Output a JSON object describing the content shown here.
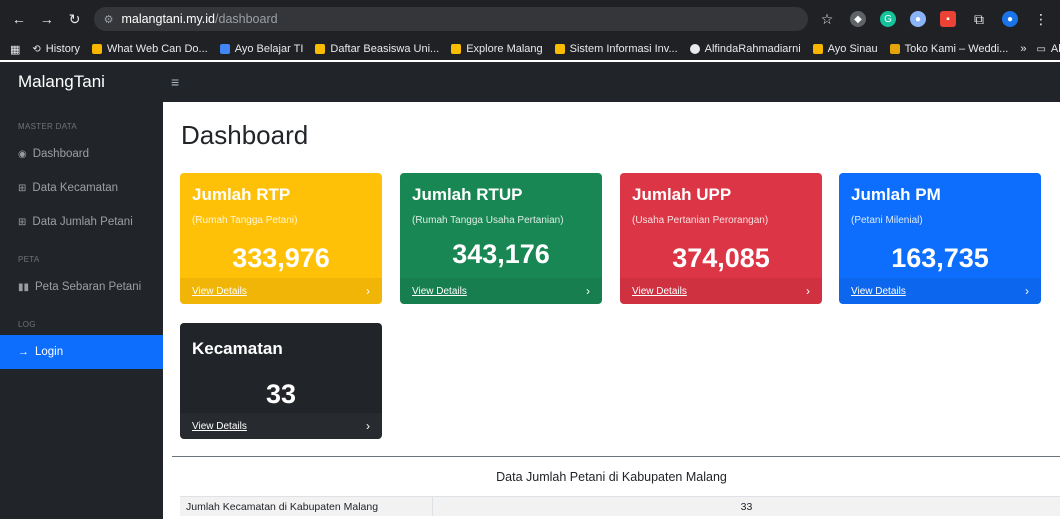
{
  "browser": {
    "host": "malangtani.my.id",
    "path": "/dashboard",
    "bookmarks": [
      "History",
      "What Web Can Do...",
      "Ayo Belajar TI",
      "Daftar Beasiswa Uni...",
      "Explore Malang",
      "Sistem Informasi Inv...",
      "AlfindaRahmadiarni",
      "Ayo Sinau",
      "Toko Kami – Weddi..."
    ],
    "more": "»",
    "all_bookmarks": "All Bookmarks"
  },
  "app": {
    "brand": "MalangTani",
    "hamburger": "≡"
  },
  "sidebar": {
    "section_master": "MASTER DATA",
    "item_dashboard": "Dashboard",
    "item_kecamatan": "Data Kecamatan",
    "item_jumlah_petani": "Data Jumlah Petani",
    "section_peta": "PETA",
    "item_peta": "Peta Sebaran Petani",
    "section_log": "LOG",
    "item_login": "Login"
  },
  "main": {
    "title": "Dashboard",
    "cards": [
      {
        "title": "Jumlah RTP",
        "subtitle": "(Rumah Tangga Petani)",
        "value": "333,976",
        "link": "View Details"
      },
      {
        "title": "Jumlah RTUP",
        "subtitle": "(Rumah Tangga Usaha Pertanian)",
        "value": "343,176",
        "link": "View Details"
      },
      {
        "title": "Jumlah UPP",
        "subtitle": "(Usaha Pertanian Perorangan)",
        "value": "374,085",
        "link": "View Details"
      },
      {
        "title": "Jumlah PM",
        "subtitle": "(Petani Milenial)",
        "value": "163,735",
        "link": "View Details"
      },
      {
        "title": "Kecamatan",
        "subtitle": "",
        "value": "33",
        "link": "View Details"
      }
    ],
    "table_title": "Data Jumlah Petani di Kabupaten Malang",
    "table_row": {
      "label": "Jumlah Kecamatan di Kabupaten Malang",
      "value": "33"
    }
  },
  "colors": {
    "yellow": "#ffc107",
    "green": "#198754",
    "red": "#dc3545",
    "blue": "#0d6efd",
    "dark": "#212529"
  }
}
